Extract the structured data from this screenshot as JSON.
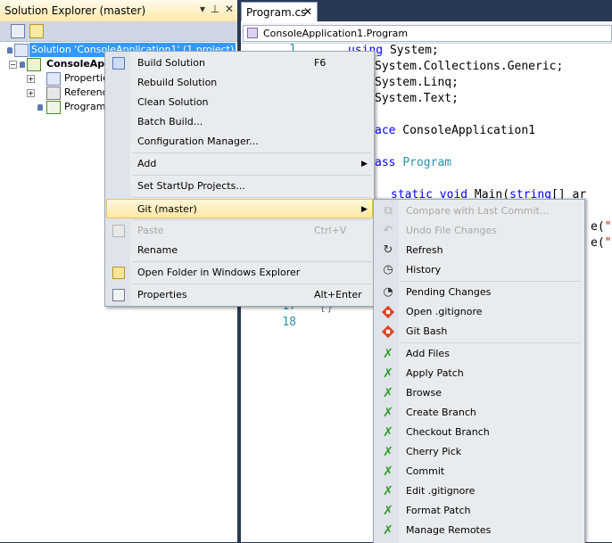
{
  "solution_explorer": {
    "title": "Solution Explorer (master)",
    "title_buttons": [
      "▾",
      "📌",
      "✕"
    ],
    "tree": {
      "solution_label": "Solution 'ConsoleApplication1' (1 project)",
      "project_label": "ConsoleApplication1",
      "children": [
        "Properties",
        "References",
        "Program.cs"
      ]
    }
  },
  "editor": {
    "tab": {
      "label": "Program.cs",
      "close": "✕"
    },
    "nav_dropdown": "ConsoleApplication1.Program",
    "line_numbers": [
      "1",
      "17",
      "18"
    ],
    "code_lines": [
      {
        "pre": "",
        "kw": "using",
        "rest": " System;"
      },
      {
        "pre": "",
        "kw": "",
        "rest": "System.Collections.Generic;"
      },
      {
        "pre": "",
        "kw": "",
        "rest": "System.Linq;"
      },
      {
        "pre": "",
        "kw": "",
        "rest": "System.Text;"
      },
      {
        "pre": "",
        "kw": "ace",
        "rest": " ConsoleApplication1"
      },
      {
        "pre": "",
        "kw": "ass",
        "rest": " Program"
      },
      {
        "pre": "",
        "kw": "static void",
        "rest": " Main(string[] ar"
      },
      {
        "pre": "",
        "kw": "",
        "rest": "e(\"H"
      },
      {
        "pre": "",
        "kw": "",
        "rest": "e(\"P"
      },
      {
        "pre": "",
        "kw": "",
        "rest": "}"
      }
    ]
  },
  "context_menu": {
    "items": [
      {
        "label": "Build Solution",
        "shortcut": "F6",
        "icon": "build-icon"
      },
      {
        "label": "Rebuild Solution",
        "shortcut": ""
      },
      {
        "label": "Clean Solution",
        "shortcut": ""
      },
      {
        "label": "Batch Build...",
        "shortcut": ""
      },
      {
        "label": "Configuration Manager...",
        "shortcut": ""
      },
      {
        "label": "Add",
        "shortcut": "",
        "submenu": true
      },
      {
        "label": "Set StartUp Projects...",
        "shortcut": ""
      },
      {
        "label": "Git (master)",
        "shortcut": "",
        "submenu": true,
        "highlighted": true
      },
      {
        "label": "Paste",
        "shortcut": "Ctrl+V",
        "disabled": true,
        "icon": "paste-icon"
      },
      {
        "label": "Rename",
        "shortcut": ""
      },
      {
        "label": "Open Folder in Windows Explorer",
        "shortcut": "",
        "icon": "folder-icon"
      },
      {
        "label": "Properties",
        "shortcut": "Alt+Enter",
        "icon": "properties-icon"
      }
    ]
  },
  "git_submenu": {
    "items": [
      {
        "label": "Compare with Last Commit...",
        "disabled": true,
        "icon": "compare-icon"
      },
      {
        "label": "Undo File Changes",
        "disabled": true,
        "icon": "undo-icon"
      },
      {
        "label": "Refresh",
        "icon": "refresh-icon"
      },
      {
        "label": "History",
        "icon": "history-icon"
      },
      {
        "label": "Pending Changes",
        "icon": "clock-icon"
      },
      {
        "label": "Open .gitignore",
        "icon": "git-icon"
      },
      {
        "label": "Git Bash",
        "icon": "git-icon"
      },
      {
        "label": "Add Files",
        "icon": "tortoise-icon"
      },
      {
        "label": "Apply Patch",
        "icon": "tortoise-icon"
      },
      {
        "label": "Browse",
        "icon": "tortoise-icon"
      },
      {
        "label": "Create Branch",
        "icon": "tortoise-icon"
      },
      {
        "label": "Checkout Branch",
        "icon": "tortoise-icon"
      },
      {
        "label": "Cherry Pick",
        "icon": "tortoise-icon"
      },
      {
        "label": "Commit",
        "icon": "tortoise-icon"
      },
      {
        "label": "Edit .gitignore",
        "icon": "tortoise-icon"
      },
      {
        "label": "Format Patch",
        "icon": "tortoise-icon"
      },
      {
        "label": "Manage Remotes",
        "icon": "tortoise-icon"
      }
    ]
  },
  "colors": {
    "highlight": "#3399ff",
    "menu_bg": "#e9ecee",
    "title_bg": "#ffe8a6",
    "chrome": "#293955"
  }
}
